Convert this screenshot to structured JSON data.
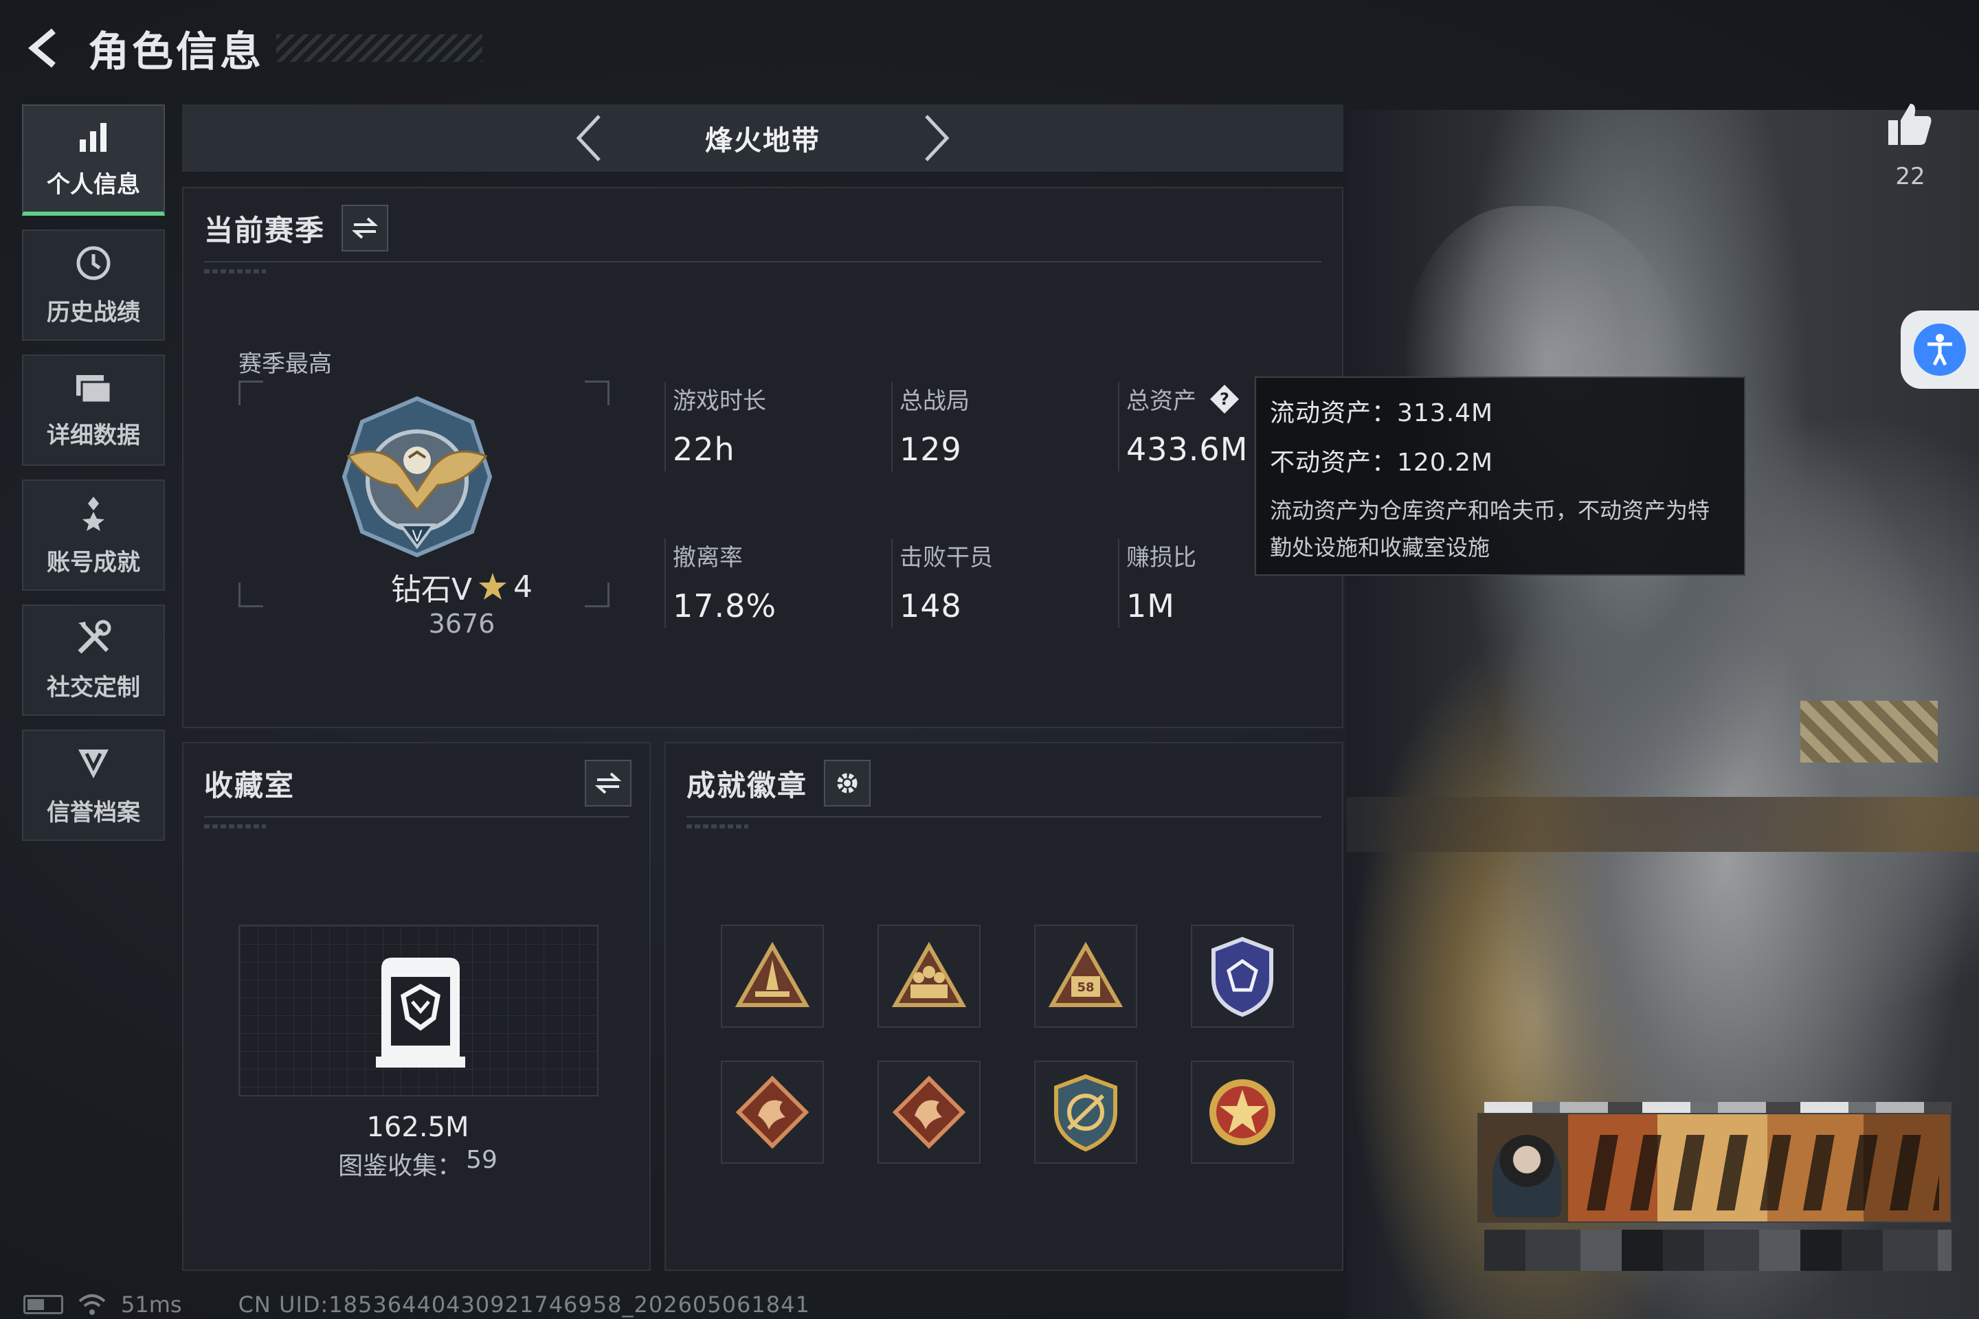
{
  "header": {
    "title": "角色信息"
  },
  "sidebar": {
    "items": [
      {
        "label": "个人信息",
        "icon": "bar-chart-icon",
        "active": true
      },
      {
        "label": "历史战绩",
        "icon": "history-clock-icon",
        "active": false
      },
      {
        "label": "详细数据",
        "icon": "folder-icon",
        "active": false
      },
      {
        "label": "账号成就",
        "icon": "achievement-star-icon",
        "active": false
      },
      {
        "label": "社交定制",
        "icon": "tools-icon",
        "active": false
      },
      {
        "label": "信誉档案",
        "icon": "shield-v-icon",
        "active": false
      }
    ]
  },
  "mode": {
    "title": "烽火地带"
  },
  "season": {
    "title": "当前赛季",
    "rank_label": "赛季最高",
    "rank_name": "钻石V",
    "rank_stars": "4",
    "rank_score": "3676",
    "stats": [
      {
        "label": "游戏时长",
        "value": "22h"
      },
      {
        "label": "总战局",
        "value": "129"
      },
      {
        "label": "总资产",
        "value": "433.6M",
        "has_help": true
      },
      {
        "label": "撤离率",
        "value": "17.8%"
      },
      {
        "label": "击败干员",
        "value": "148"
      },
      {
        "label": "赚损比",
        "value": "1M"
      }
    ]
  },
  "tooltip": {
    "liquid": "流动资产：313.4M",
    "fixed": "不动资产：120.2M",
    "desc": "流动资产为仓库资产和哈夫币，不动资产为特勤处设施和收藏室设施"
  },
  "collection": {
    "title": "收藏室",
    "value": "162.5M",
    "count_label": "图鉴收集：",
    "count": "59"
  },
  "achievements": {
    "title": "成就徽章",
    "badges": [
      {
        "icon": "triangle-rocket-badge-icon",
        "color": "#c9a25a"
      },
      {
        "icon": "triangle-soldiers-badge-icon",
        "color": "#c9a25a"
      },
      {
        "icon": "triangle-58-badge-icon",
        "color": "#c9a25a"
      },
      {
        "icon": "shield-gem-badge-icon",
        "color": "#6a74c8"
      },
      {
        "icon": "dragon-diamond-badge-icon",
        "color": "#b05a3a"
      },
      {
        "icon": "dragon-diamond-badge-icon",
        "color": "#b05a3a"
      },
      {
        "icon": "target-shield-badge-icon",
        "color": "#d1a64a"
      },
      {
        "icon": "star-medal-badge-icon",
        "color": "#c84a3a"
      }
    ]
  },
  "likes": {
    "count": "22"
  },
  "status": {
    "ping": "51ms",
    "uid": "CN UID:18536440430921746958_202605061841"
  },
  "colors": {
    "accent_green": "#5fd08a",
    "panel_bg": "#1f2329",
    "access_blue": "#3a87ff"
  }
}
